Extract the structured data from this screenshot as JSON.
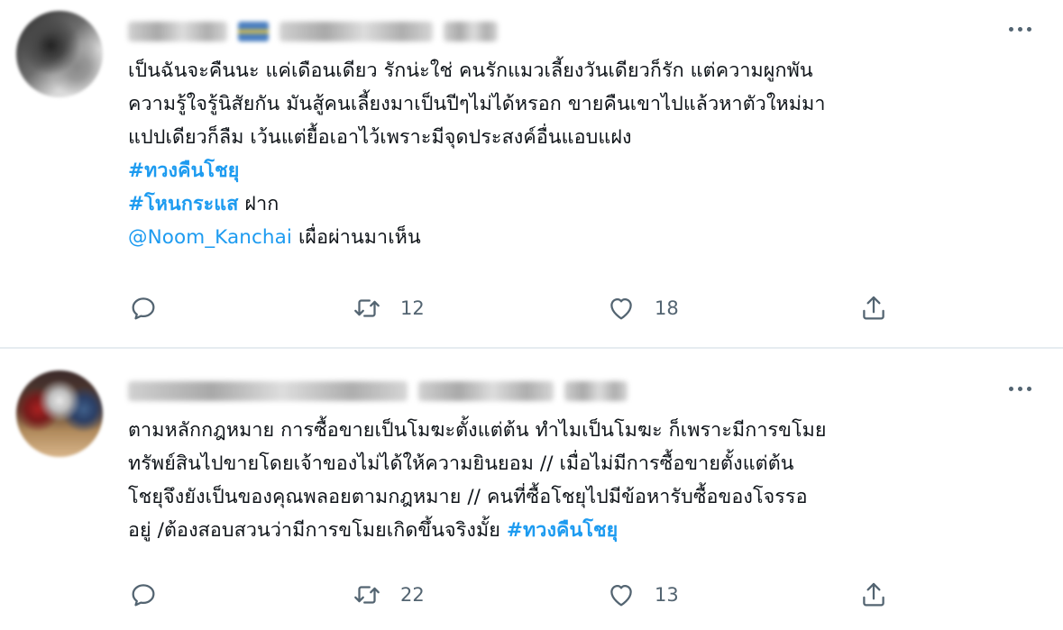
{
  "tweets": [
    {
      "lines": [
        "เป็นฉันจะคืนนะ แค่เดือนเดียว รักน่ะใช่ คนรักแมวเลี้ยงวันเดียวก็รัก แต่ความผูกพัน",
        "ความรู้ใจรู้นิสัยกัน มันสู้คนเลี้ยงมาเป็นปีๆไม่ได้หรอก ขายคืนเขาไปแล้วหาตัวใหม่มา",
        "แปปเดียวก็ลืม เว้นแต่ยื้อเอาไว้เพราะมีจุดประสงค์อื่นแอบแฝง"
      ],
      "hashtag1": "#ทวงคืนโชยุ",
      "hashtag2": "#โหนกระแส",
      "hashtag2_suffix": " ฝาก",
      "mention": "@Noom_Kanchai",
      "mention_suffix": " เผื่อผ่านมาเห็น",
      "retweets": "12",
      "likes": "18"
    },
    {
      "lines": [
        "ตามหลักกฎหมาย การซื้อขายเป็นโมฆะตั้งแต่ต้น ทำไมเป็นโมฆะ ก็เพราะมีการขโมย",
        "ทรัพย์สินไปขายโดยเจ้าของไม่ได้ให้ความยินยอม // เมื่อไม่มีการซื้อขายตั้งแต่ต้น",
        "โชยุจึงยังเป็นของคุณพลอยตามกฎหมาย // คนที่ซื้อโชยุไปมีข้อหารับซื้อของโจรรอ"
      ],
      "last_line": "อยู่ /ต้องสอบสวนว่ามีการขโมยเกิดขึ้นจริงมั้ย ",
      "hashtag": "#ทวงคืนโชยุ",
      "retweets": "22",
      "likes": "13"
    }
  ],
  "icons": {
    "reply": "reply-icon",
    "retweet": "retweet-icon",
    "like": "heart-icon",
    "share": "share-icon",
    "more": "more-icon"
  },
  "colors": {
    "link": "#1d9bf0",
    "text": "#0f1419",
    "secondary": "#536471",
    "divider": "#e6ecf0"
  }
}
